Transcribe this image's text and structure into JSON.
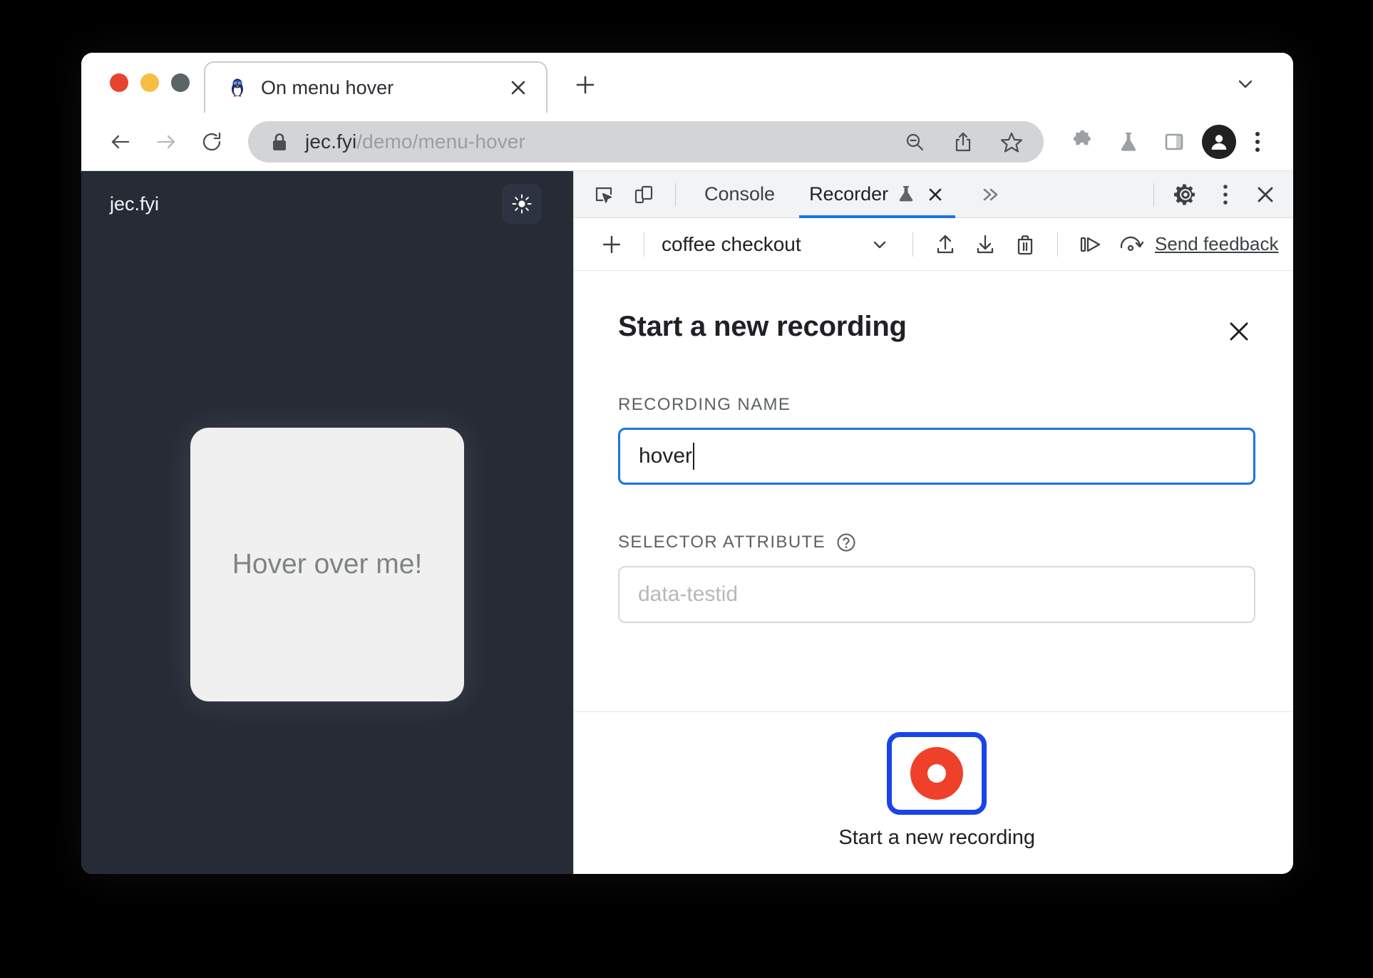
{
  "browser": {
    "tab": {
      "title": "On menu hover",
      "favicon_icon": "penguin-favicon",
      "close_icon": "close-icon"
    },
    "new_tab_icon": "plus-icon",
    "tabstrip_chevron_icon": "chevron-down-icon",
    "toolbar": {
      "back_icon": "back-arrow-icon",
      "forward_icon": "forward-arrow-icon",
      "reload_icon": "reload-icon",
      "lock_icon": "lock-icon",
      "url_host": "jec.fyi",
      "url_path": "/demo/menu-hover",
      "zoom_out_icon": "zoom-out-icon",
      "share_icon": "share-icon",
      "bookmark_icon": "star-icon",
      "extensions_icon": "puzzle-icon",
      "experiments_icon": "flask-icon",
      "side_panel_icon": "side-panel-icon",
      "profile_icon": "avatar-icon",
      "menu_icon": "three-dot-menu-icon"
    }
  },
  "page": {
    "brand": "jec.fyi",
    "theme_toggle_icon": "sun-icon",
    "hover_card_text": "Hover over me!"
  },
  "devtools": {
    "inspect_icon": "inspect-element-icon",
    "device_toolbar_icon": "device-toolbar-icon",
    "tabs": [
      {
        "label": "Console",
        "active": false,
        "has_flask": false,
        "has_close": false
      },
      {
        "label": "Recorder",
        "active": true,
        "has_flask": true,
        "has_close": true
      }
    ],
    "flask_icon": "flask-icon",
    "tab_close_icon": "close-icon",
    "more_tabs_icon": "chevron-double-right-icon",
    "settings_icon": "gear-icon",
    "dots_icon": "three-dot-menu-icon",
    "close_icon": "close-icon",
    "recorder_toolbar": {
      "add_icon": "plus-icon",
      "selected_recording": "coffee checkout",
      "select_chevron_icon": "chevron-down-icon",
      "export_icon": "export-upload-icon",
      "import_icon": "import-download-icon",
      "delete_icon": "trash-icon",
      "replay_icon": "step-replay-icon",
      "speed_icon": "replay-speed-icon",
      "feedback_label": "Send feedback"
    },
    "recorder_panel": {
      "title": "Start a new recording",
      "close_icon": "close-icon",
      "recording_name_label": "RECORDING NAME",
      "recording_name_value": "hover",
      "selector_attribute_label": "SELECTOR ATTRIBUTE",
      "selector_help_icon": "help-circle-icon",
      "selector_attribute_placeholder": "data-testid",
      "selector_attribute_value": "",
      "record_button_icon": "record-circle-icon",
      "record_button_caption": "Start a new recording"
    }
  },
  "colors": {
    "accent_blue": "#1a73e8",
    "focus_blue": "#1a44e8",
    "record_red": "#ef4129",
    "page_dark": "#262b36",
    "traffic_red": "#e8432f",
    "traffic_yellow": "#f9bd45",
    "traffic_grey": "#5b6466"
  }
}
